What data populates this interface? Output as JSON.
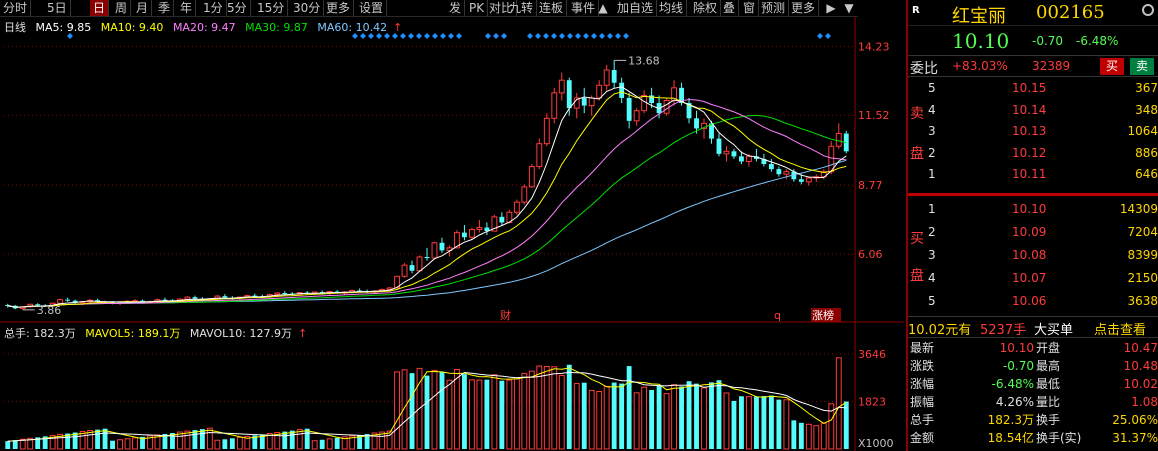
{
  "toolbar": {
    "left_items": [
      "分时",
      "5日",
      "日",
      "周",
      "月",
      "季",
      "年",
      "1分",
      "5分",
      "15分",
      "30分",
      "更多",
      "设置"
    ],
    "right_items": [
      "发",
      "PK",
      "对比",
      "九转",
      "连板",
      "事件",
      "加自选",
      "均线",
      "除权",
      "叠",
      "窗",
      "预测",
      "更多"
    ],
    "active": "日"
  },
  "legend": {
    "label": "日线",
    "ma5": "MA5: 9.85",
    "ma10": "MA10: 9.40",
    "ma20": "MA20: 9.47",
    "ma30": "MA30: 9.87",
    "ma60": "MA60: 10.42",
    "arrow": "↑"
  },
  "vol_legend": {
    "total": "总手: 182.3万",
    "mavol5": "MAVOL5: 189.1万",
    "mavol10": "MAVOL10: 127.9万",
    "arrow": "↑"
  },
  "axis": {
    "price_ticks": [
      "14.23",
      "11.52",
      "8.77",
      "6.06"
    ],
    "vol_ticks": [
      "3646",
      "1823"
    ],
    "vol_unit": "X1000",
    "high_label": "13.68",
    "low_label": "3.86",
    "event_cai": "财",
    "event_q": "q",
    "event_zhangbang": "涨榜"
  },
  "colors": {
    "up": "#ff3b3b",
    "down": "#54fcfc",
    "ma5": "#ffffff",
    "ma10": "#ffff00",
    "ma20": "#ff80ff",
    "ma30": "#00e000",
    "ma60": "#80c8ff",
    "grid": "#8b0000",
    "marker": "#1e90ff"
  },
  "chart_data": {
    "type": "candlestick",
    "title": "日线",
    "ylim": [
      3.5,
      14.6
    ],
    "candles": [
      [
        4.05,
        4.1,
        3.95,
        4.02
      ],
      [
        4.02,
        4.05,
        3.88,
        3.92
      ],
      [
        3.92,
        4.0,
        3.86,
        3.98
      ],
      [
        3.98,
        4.1,
        3.95,
        4.08
      ],
      [
        4.08,
        4.12,
        4.0,
        4.04
      ],
      [
        4.04,
        4.08,
        3.98,
        4.01
      ],
      [
        4.01,
        4.15,
        4.0,
        4.12
      ],
      [
        4.12,
        4.3,
        4.1,
        4.26
      ],
      [
        4.26,
        4.34,
        4.18,
        4.22
      ],
      [
        4.22,
        4.26,
        4.1,
        4.14
      ],
      [
        4.14,
        4.2,
        4.05,
        4.18
      ],
      [
        4.18,
        4.28,
        4.12,
        4.24
      ],
      [
        4.24,
        4.3,
        4.15,
        4.18
      ],
      [
        4.18,
        4.22,
        4.1,
        4.16
      ],
      [
        4.16,
        4.2,
        4.08,
        4.12
      ],
      [
        4.12,
        4.18,
        4.05,
        4.15
      ],
      [
        4.15,
        4.24,
        4.1,
        4.2
      ],
      [
        4.2,
        4.28,
        4.16,
        4.22
      ],
      [
        4.22,
        4.26,
        4.12,
        4.16
      ],
      [
        4.16,
        4.22,
        4.1,
        4.18
      ],
      [
        4.18,
        4.3,
        4.15,
        4.26
      ],
      [
        4.26,
        4.34,
        4.2,
        4.24
      ],
      [
        4.24,
        4.28,
        4.15,
        4.2
      ],
      [
        4.2,
        4.32,
        4.18,
        4.28
      ],
      [
        4.28,
        4.4,
        4.24,
        4.36
      ],
      [
        4.36,
        4.42,
        4.26,
        4.3
      ],
      [
        4.3,
        4.36,
        4.2,
        4.26
      ],
      [
        4.26,
        4.32,
        4.18,
        4.3
      ],
      [
        4.3,
        4.45,
        4.28,
        4.4
      ],
      [
        4.4,
        4.48,
        4.3,
        4.34
      ],
      [
        4.34,
        4.4,
        4.26,
        4.32
      ],
      [
        4.32,
        4.38,
        4.25,
        4.36
      ],
      [
        4.36,
        4.46,
        4.32,
        4.42
      ],
      [
        4.42,
        4.5,
        4.36,
        4.4
      ],
      [
        4.4,
        4.46,
        4.32,
        4.38
      ],
      [
        4.38,
        4.5,
        4.34,
        4.46
      ],
      [
        4.46,
        4.56,
        4.4,
        4.52
      ],
      [
        4.52,
        4.6,
        4.45,
        4.5
      ],
      [
        4.5,
        4.56,
        4.42,
        4.48
      ],
      [
        4.48,
        4.56,
        4.44,
        4.54
      ],
      [
        4.54,
        4.6,
        4.46,
        4.5
      ],
      [
        4.5,
        4.58,
        4.44,
        4.56
      ],
      [
        4.56,
        4.62,
        4.48,
        4.52
      ],
      [
        4.52,
        4.6,
        4.45,
        4.58
      ],
      [
        4.58,
        4.64,
        4.5,
        4.54
      ],
      [
        4.54,
        4.6,
        4.46,
        4.56
      ],
      [
        4.56,
        4.66,
        4.52,
        4.62
      ],
      [
        4.62,
        4.7,
        4.55,
        4.6
      ],
      [
        4.6,
        4.66,
        4.52,
        4.58
      ],
      [
        4.58,
        4.64,
        4.5,
        4.6
      ],
      [
        4.6,
        4.7,
        4.56,
        4.66
      ],
      [
        4.66,
        4.76,
        4.6,
        4.72
      ],
      [
        4.72,
        5.2,
        4.7,
        5.18
      ],
      [
        5.18,
        5.7,
        5.12,
        5.62
      ],
      [
        5.62,
        5.8,
        5.3,
        5.4
      ],
      [
        5.4,
        6.0,
        5.36,
        5.94
      ],
      [
        5.94,
        6.3,
        5.8,
        5.9
      ],
      [
        5.9,
        6.54,
        5.88,
        6.5
      ],
      [
        6.5,
        6.7,
        6.1,
        6.2
      ],
      [
        6.2,
        6.4,
        5.96,
        6.3
      ],
      [
        6.3,
        7.0,
        6.28,
        6.9
      ],
      [
        6.9,
        7.2,
        6.6,
        6.72
      ],
      [
        6.72,
        7.1,
        6.6,
        7.02
      ],
      [
        7.02,
        7.4,
        6.9,
        7.1
      ],
      [
        7.1,
        7.3,
        6.8,
        6.96
      ],
      [
        6.96,
        7.6,
        6.94,
        7.52
      ],
      [
        7.52,
        7.7,
        7.2,
        7.3
      ],
      [
        7.3,
        7.8,
        7.26,
        7.7
      ],
      [
        7.7,
        8.2,
        7.6,
        8.1
      ],
      [
        8.1,
        8.8,
        8.0,
        8.7
      ],
      [
        8.7,
        9.6,
        8.66,
        9.5
      ],
      [
        9.5,
        10.6,
        9.4,
        10.4
      ],
      [
        10.4,
        11.6,
        10.3,
        11.4
      ],
      [
        11.4,
        12.6,
        11.2,
        12.4
      ],
      [
        12.4,
        13.2,
        12.1,
        12.9
      ],
      [
        12.9,
        13.0,
        11.5,
        11.8
      ],
      [
        11.8,
        12.4,
        11.4,
        12.2
      ],
      [
        12.2,
        12.6,
        11.6,
        11.9
      ],
      [
        11.9,
        12.3,
        11.5,
        12.2
      ],
      [
        12.2,
        12.9,
        12.1,
        12.7
      ],
      [
        12.7,
        13.5,
        12.5,
        13.3
      ],
      [
        13.3,
        13.68,
        12.6,
        12.8
      ],
      [
        12.8,
        13.0,
        12.0,
        12.2
      ],
      [
        12.2,
        12.4,
        11.0,
        11.3
      ],
      [
        11.3,
        11.8,
        11.1,
        11.7
      ],
      [
        11.7,
        12.5,
        11.6,
        12.3
      ],
      [
        12.3,
        12.6,
        11.8,
        12.0
      ],
      [
        12.0,
        12.3,
        11.4,
        11.6
      ],
      [
        11.6,
        12.2,
        11.5,
        12.1
      ],
      [
        12.1,
        12.9,
        11.9,
        12.6
      ],
      [
        12.6,
        12.8,
        11.9,
        12.0
      ],
      [
        12.0,
        12.2,
        11.2,
        11.4
      ],
      [
        11.4,
        11.7,
        10.8,
        11.0
      ],
      [
        11.0,
        11.4,
        10.6,
        11.2
      ],
      [
        11.2,
        11.3,
        10.4,
        10.6
      ],
      [
        10.6,
        10.8,
        9.9,
        10.0
      ],
      [
        10.0,
        10.3,
        9.7,
        10.1
      ],
      [
        10.1,
        10.2,
        9.8,
        9.9
      ],
      [
        9.9,
        10.1,
        9.6,
        9.7
      ],
      [
        9.7,
        10.0,
        9.5,
        9.9
      ],
      [
        9.9,
        10.2,
        9.7,
        9.8
      ],
      [
        9.8,
        10.0,
        9.5,
        9.6
      ],
      [
        9.6,
        9.8,
        9.3,
        9.4
      ],
      [
        9.4,
        9.5,
        9.1,
        9.2
      ],
      [
        9.2,
        9.4,
        9.0,
        9.3
      ],
      [
        9.3,
        9.4,
        8.9,
        9.0
      ],
      [
        9.0,
        9.2,
        8.8,
        8.9
      ],
      [
        8.9,
        9.1,
        8.75,
        9.05
      ],
      [
        9.05,
        9.2,
        8.9,
        9.1
      ],
      [
        9.1,
        9.4,
        9.0,
        9.3
      ],
      [
        9.3,
        10.5,
        9.2,
        10.3
      ],
      [
        10.3,
        11.2,
        10.2,
        10.8
      ],
      [
        10.8,
        10.9,
        10.02,
        10.1
      ]
    ],
    "high_point": 13.68,
    "low_point": 3.86,
    "volume_ylim": [
      0,
      3800
    ],
    "volume_unit": "X1000"
  }
}
